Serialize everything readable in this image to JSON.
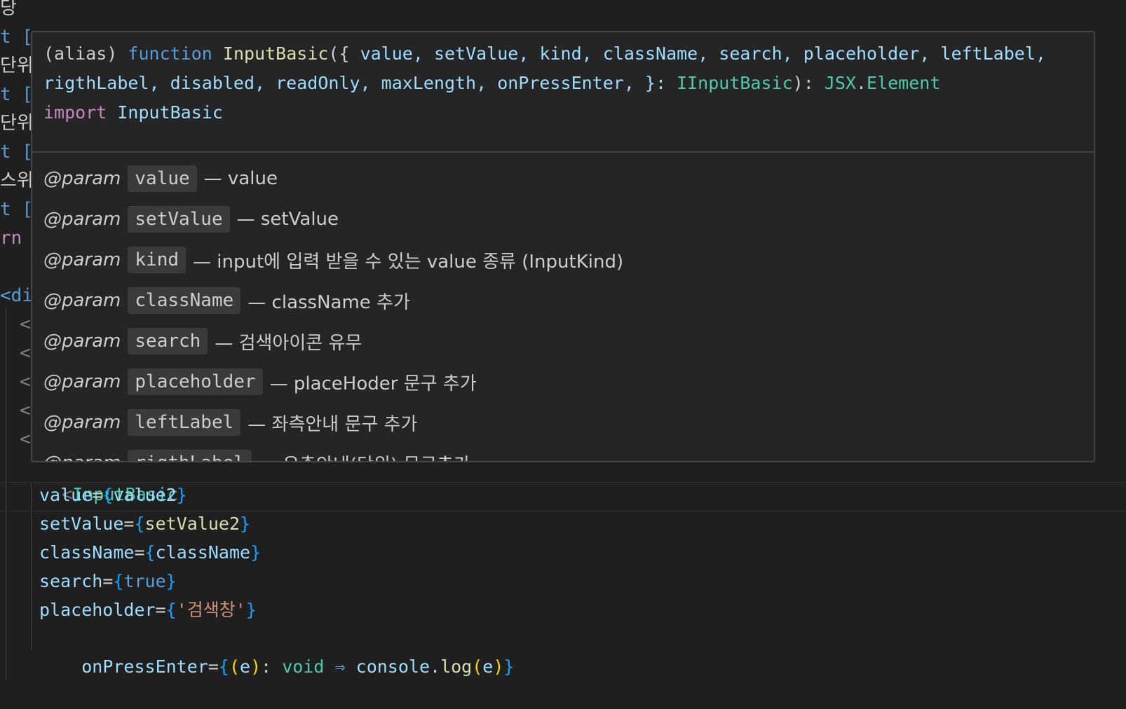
{
  "colors": {
    "editor_bg": "#1f1f1f",
    "hover_bg": "#252526",
    "border": "#454545",
    "keyword": "#569cd6",
    "function": "#dcdcaa",
    "type": "#4ec9b0",
    "variable": "#9cdcfe",
    "string": "#ce9178",
    "import": "#c586c0",
    "bracket_blue": "#179fff",
    "bracket_gold": "#ffd700"
  },
  "left_fragments": [
    {
      "text": "당",
      "color": "#cccccc"
    },
    {
      "text": "t [",
      "color": "#569cd6"
    },
    {
      "text": "단위",
      "color": "#cccccc"
    },
    {
      "text": "t [",
      "color": "#569cd6"
    },
    {
      "text": "단위",
      "color": "#cccccc"
    },
    {
      "text": "t [",
      "color": "#569cd6"
    },
    {
      "text": "스위",
      "color": "#cccccc"
    },
    {
      "text": "t [",
      "color": "#569cd6"
    },
    {
      "text": "rn",
      "color": "#c586c0"
    },
    {
      "text": "",
      "color": "#cccccc"
    },
    {
      "text": "<di",
      "color": "#569cd6"
    },
    {
      "text": "<",
      "color": "#808080"
    },
    {
      "text": "<",
      "color": "#808080"
    },
    {
      "text": "<",
      "color": "#808080"
    },
    {
      "text": "<",
      "color": "#808080"
    },
    {
      "text": "<",
      "color": "#808080"
    }
  ],
  "hover": {
    "signature": {
      "alias": "(alias)",
      "function_kw": "function",
      "name": "InputBasic",
      "params_open": "({",
      "line1_params": " value, setValue, kind, className, search, placeholder, leftLabel,",
      "line2_params": "rigthLabel, disabled, readOnly, maxLength, onPressEnter, }: ",
      "param_type": "IInputBasic",
      "ret_sep": "): ",
      "ret_ns": "JSX",
      "ret_dot": ".",
      "ret_type": "Element",
      "import_kw": "import",
      "import_name": "InputBasic"
    },
    "param_tag": "@param",
    "params": [
      {
        "name": "value",
        "desc": "— value"
      },
      {
        "name": "setValue",
        "desc": "— setValue"
      },
      {
        "name": "kind",
        "desc": "— input에 입력 받을 수 있는 value 종류 (InputKind)"
      },
      {
        "name": "className",
        "desc": "— className 추가"
      },
      {
        "name": "search",
        "desc": "— 검색아이콘 유무"
      },
      {
        "name": "placeholder",
        "desc": "— placeHoder 문구 추가"
      },
      {
        "name": "leftLabel",
        "desc": "— 좌측안내 문구 추가"
      },
      {
        "name": "rigthLabel",
        "desc": "— 우측안내(단위) 문구추가"
      }
    ]
  },
  "code": {
    "component_open": "<",
    "component_name": "InputBasic",
    "props": [
      {
        "name": "value",
        "eq": "=",
        "open": "{",
        "val": "value2",
        "close": "}",
        "val_kind": "var"
      },
      {
        "name": "setValue",
        "eq": "=",
        "open": "{",
        "val": "setValue2",
        "close": "}",
        "val_kind": "fn"
      },
      {
        "name": "className",
        "eq": "=",
        "open": "{",
        "val": "className",
        "close": "}",
        "val_kind": "var"
      },
      {
        "name": "search",
        "eq": "=",
        "open": "{",
        "val": "true",
        "close": "}",
        "val_kind": "kw"
      },
      {
        "name": "placeholder",
        "eq": "=",
        "open": "{",
        "val": "'검색창'",
        "close": "}",
        "val_kind": "str"
      }
    ],
    "last_prop": {
      "name": "onPressEnter",
      "eq": "=",
      "open": "{",
      "arg_open": "(",
      "arg": "e",
      "arg_close": ")",
      "colon": ": ",
      "ret": "void",
      "arrow": " ⇒ ",
      "obj": "console",
      "dot": ".",
      "method": "log",
      "call_open": "(",
      "call_arg": "e",
      "call_close": ")",
      "close": "}"
    }
  }
}
